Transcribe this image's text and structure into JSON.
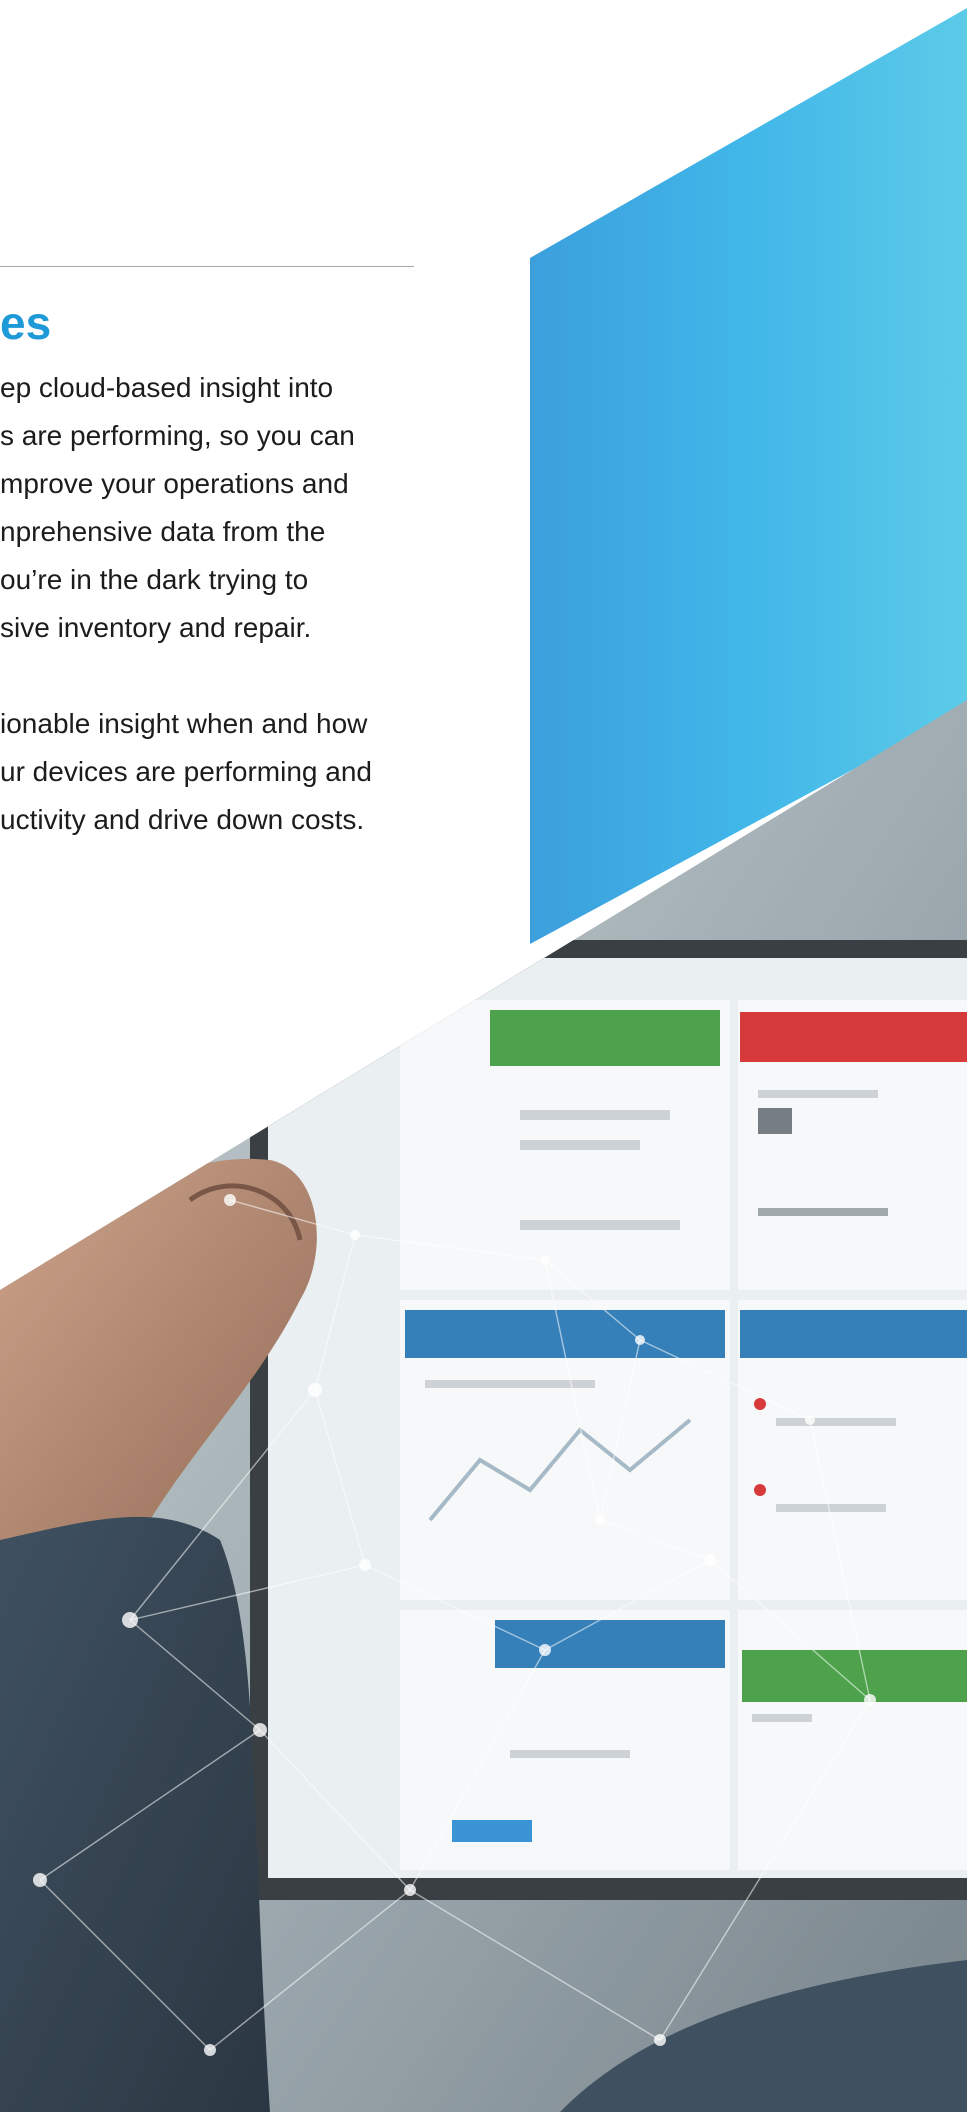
{
  "section": {
    "heading": "es",
    "paragraph_1": [
      "ep cloud-based insight into",
      "s are performing, so you can",
      "mprove your operations and",
      "nprehensive data from the",
      "ou’re in the dark trying to",
      "sive inventory and repair."
    ],
    "paragraph_2": [
      "ionable insight when and how",
      "ur devices are performing and",
      "uctivity and drive down costs."
    ]
  },
  "colors": {
    "accent": "#1f9ad8",
    "panel_gradient_start": "#3b9fdc",
    "panel_gradient_end": "#5ccbe8",
    "body_text": "#1c1c1c",
    "rule": "#a9a9a9"
  },
  "photo": {
    "description_icon": "dashboard-photo",
    "dashboard_tiles": [
      {
        "header_color": "#3e9b3c"
      },
      {
        "header_color": "#d42a2a"
      },
      {
        "header_color": "#2576b4"
      },
      {
        "header_color": "#2576b4"
      },
      {
        "header_color": "#2576b4"
      },
      {
        "header_color": "#3e9b3c"
      }
    ]
  }
}
